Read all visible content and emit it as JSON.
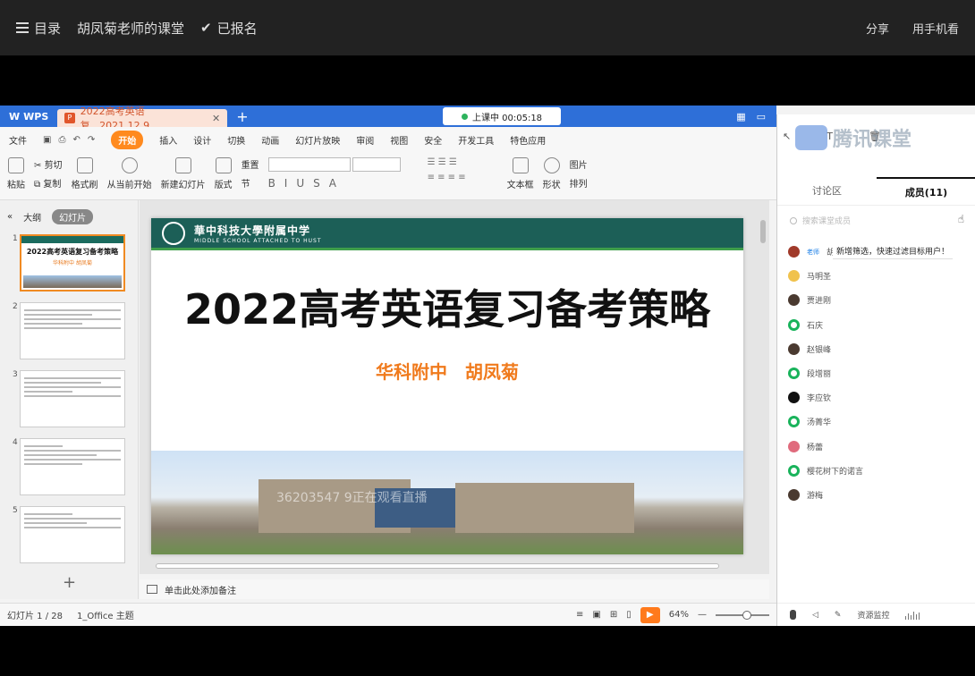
{
  "topbar": {
    "menu_label": "目录",
    "course_title": "胡凤菊老师的课堂",
    "enrolled_label": "已报名",
    "share_label": "分享",
    "mobile_label": "用手机看"
  },
  "wps": {
    "app_label": "WPS",
    "doc_tab": "2022高考英语复...2021.12.9",
    "live_status": "上课中 00:05:18",
    "menu": [
      "文件",
      "开始",
      "插入",
      "设计",
      "切换",
      "动画",
      "幻灯片放映",
      "审阅",
      "视图",
      "安全",
      "开发工具",
      "特色应用"
    ],
    "ribbon": {
      "paste": "粘贴",
      "cut": "剪切",
      "copy": "复制",
      "format_painter": "格式刷",
      "play_from_current": "从当前开始",
      "new_slide": "新建幻灯片",
      "layout": "版式",
      "reset": "重置",
      "section": "节",
      "textbox": "文本框",
      "shape": "形状",
      "picture": "图片",
      "arrange": "排列"
    },
    "thumb_tabs": {
      "outline": "大纲",
      "slides": "幻灯片"
    },
    "thumb_numbers": [
      "1",
      "2",
      "3",
      "4",
      "5"
    ],
    "thumb1_title": "2022高考英语复习备考策略",
    "thumb1_sub": "华科附中 胡凤菊",
    "notes_placeholder": "单击此处添加备注",
    "status": {
      "slide_counter": "幻灯片 1 / 28",
      "theme": "1_Office 主题",
      "zoom": "64%"
    }
  },
  "slide": {
    "school_cn": "華中科技大學附属中学",
    "school_en": "MIDDLE SCHOOL ATTACHED TO HUST",
    "title": "2022高考英语复习备考策略",
    "subtitle": "华科附中　胡凤菊",
    "watermark": "36203547 9正在观看直播"
  },
  "panel": {
    "brand": "腾讯课堂",
    "tabs": [
      "讨论区",
      "成员(11)"
    ],
    "search_placeholder": "搜索课堂成员",
    "tip": "新增筛选，快速过滤目标用户！",
    "teacher_role": "老师",
    "members": [
      {
        "name": "胡",
        "avatar": "teacher"
      },
      {
        "name": "马明圣",
        "avatar": "yellow"
      },
      {
        "name": "贾进刚",
        "avatar": "face"
      },
      {
        "name": "石庆",
        "avatar": "green"
      },
      {
        "name": "赵银峰",
        "avatar": "face"
      },
      {
        "name": "段增丽",
        "avatar": "green"
      },
      {
        "name": "李应钦",
        "avatar": "black"
      },
      {
        "name": "汤菁华",
        "avatar": "green"
      },
      {
        "name": "杨蕾",
        "avatar": "pink"
      },
      {
        "name": "樱花树下的诺言",
        "avatar": "green"
      },
      {
        "name": "游梅",
        "avatar": "face"
      }
    ],
    "resource_monitor": "资源监控"
  }
}
